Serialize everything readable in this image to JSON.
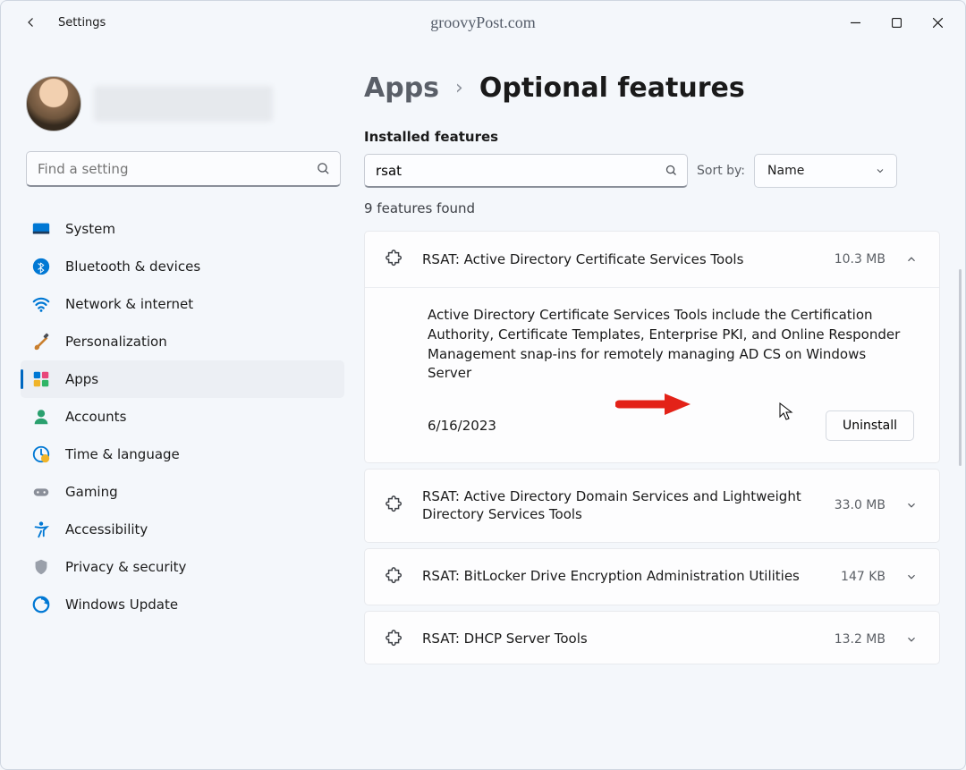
{
  "titlebar": {
    "title": "Settings",
    "watermark": "groovyPost.com"
  },
  "sidebar": {
    "search_placeholder": "Find a setting",
    "items": [
      {
        "label": "System"
      },
      {
        "label": "Bluetooth & devices"
      },
      {
        "label": "Network & internet"
      },
      {
        "label": "Personalization"
      },
      {
        "label": "Apps",
        "selected": true
      },
      {
        "label": "Accounts"
      },
      {
        "label": "Time & language"
      },
      {
        "label": "Gaming"
      },
      {
        "label": "Accessibility"
      },
      {
        "label": "Privacy & security"
      },
      {
        "label": "Windows Update"
      }
    ]
  },
  "content": {
    "breadcrumb_parent": "Apps",
    "breadcrumb_current": "Optional features",
    "section_label": "Installed features",
    "filter_value": "rsat",
    "sort_label": "Sort by:",
    "sort_value": "Name",
    "count_text": "9 features found",
    "features": [
      {
        "title": "RSAT: Active Directory Certificate Services Tools",
        "size": "10.3 MB",
        "expanded": true,
        "description": "Active Directory Certificate Services Tools include the Certification Authority, Certificate Templates, Enterprise PKI, and Online Responder Management snap-ins for remotely managing AD CS on Windows Server",
        "date": "6/16/2023",
        "uninstall_label": "Uninstall"
      },
      {
        "title": "RSAT: Active Directory Domain Services and Lightweight Directory Services Tools",
        "size": "33.0 MB",
        "expanded": false
      },
      {
        "title": "RSAT: BitLocker Drive Encryption Administration Utilities",
        "size": "147 KB",
        "expanded": false
      },
      {
        "title": "RSAT: DHCP Server Tools",
        "size": "13.2 MB",
        "expanded": false
      }
    ]
  }
}
